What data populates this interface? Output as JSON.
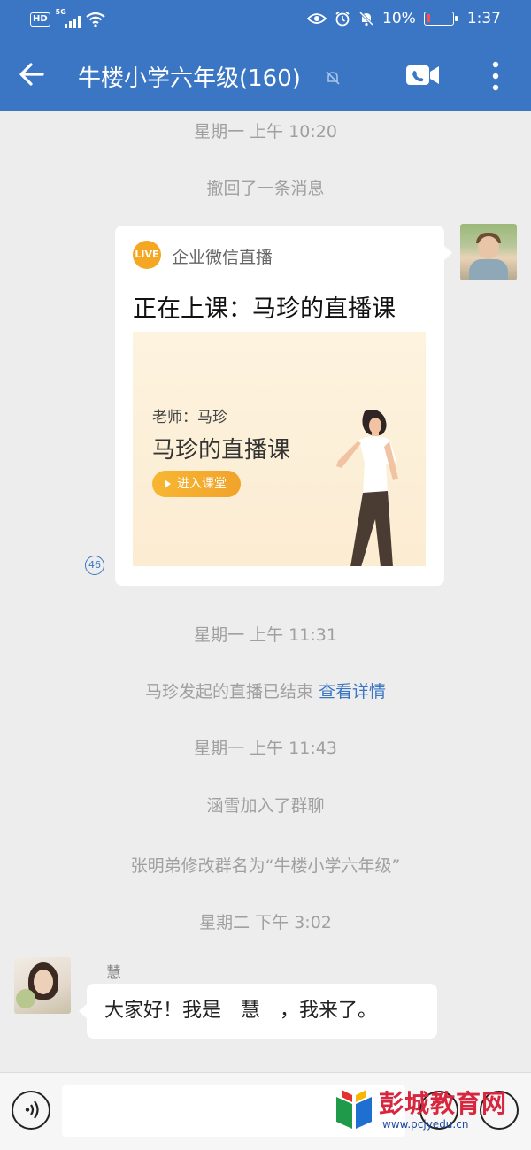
{
  "status_bar": {
    "hd": "HD",
    "network": "5G",
    "battery_percent": "10%",
    "battery_level": 0.1,
    "time": "1:37"
  },
  "header": {
    "title": "牛楼小学六年级(160)",
    "icons": [
      "back-arrow-icon",
      "mute-icon",
      "video-call-icon",
      "more-icon"
    ]
  },
  "messages": {
    "ts1": "星期一 上午 10:20",
    "recall": "撤回了一条消息",
    "card": {
      "badge": "LIVE",
      "source": "企业微信直播",
      "title": "正在上课：马珍的直播课",
      "teacher": "老师：马珍",
      "course": "马珍的直播课",
      "enter": "进入课堂",
      "read_count": "46"
    },
    "ts2": "星期一 上午 11:31",
    "ended": "马珍发起的直播已结束",
    "ended_link": "查看详情",
    "ts3": "星期一 上午 11:43",
    "joined": "涵雪加入了群聊",
    "renamed": "张明弟修改群名为“牛楼小学六年级”",
    "ts4": "星期二 下午 3:02",
    "sender": "慧",
    "text": "大家好！我是　慧　，我来了。"
  },
  "input_bar": {
    "icons": [
      "voice-icon",
      "emoji-icon",
      "plus-icon"
    ]
  },
  "watermark": {
    "name": "彭城教育网",
    "url": "www.pcjyedu.cn"
  },
  "colors": {
    "header_bg": "#3b76c4",
    "chat_bg": "#ededed",
    "live_orange": "#f5a623",
    "link_blue": "#3b76c4"
  }
}
